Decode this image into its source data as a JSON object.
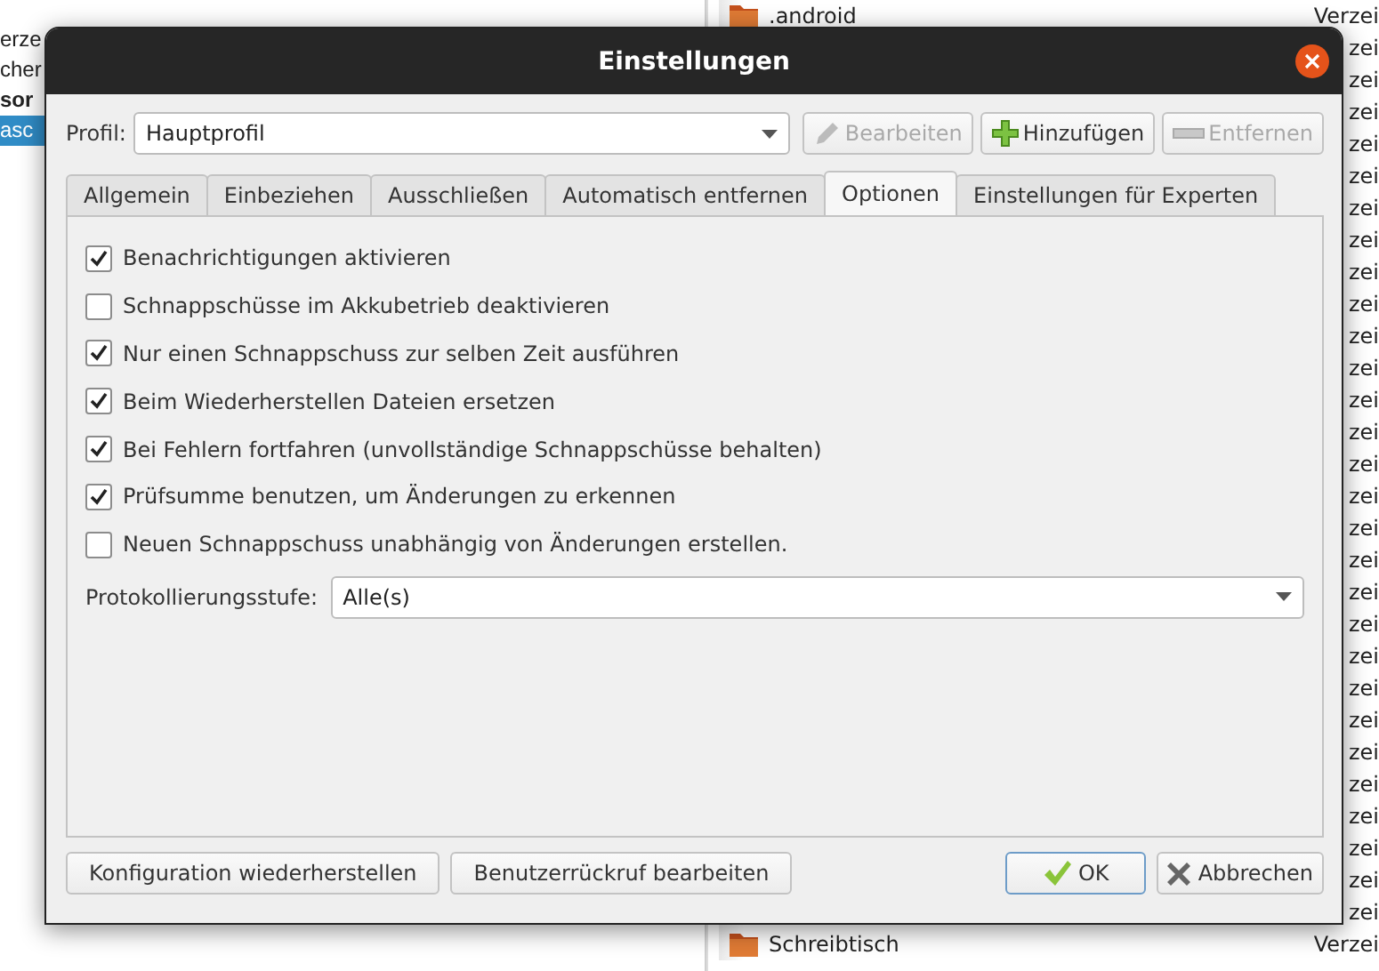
{
  "background": {
    "left_rows": [
      {
        "text": "erze",
        "bold": false,
        "selected": false
      },
      {
        "text": "cher",
        "bold": false,
        "selected": false
      },
      {
        "text": "sor",
        "bold": true,
        "selected": false
      },
      {
        "text": "asc",
        "bold": false,
        "selected": true
      }
    ],
    "file_rows": [
      {
        "name": ".android",
        "type": "Verzei"
      },
      {
        "type": "zei"
      },
      {
        "type": "zei"
      },
      {
        "type": "zei"
      },
      {
        "type": "zei"
      },
      {
        "type": "zei"
      },
      {
        "type": "zei"
      },
      {
        "type": "zei"
      },
      {
        "type": "zei"
      },
      {
        "type": "zei"
      },
      {
        "type": "zei"
      },
      {
        "type": "zei"
      },
      {
        "type": "zei"
      },
      {
        "type": "zei"
      },
      {
        "type": "zei"
      },
      {
        "type": "zei"
      },
      {
        "type": "zei"
      },
      {
        "type": "zei"
      },
      {
        "type": "zei"
      },
      {
        "type": "zei"
      },
      {
        "type": "zei"
      },
      {
        "type": "zei"
      },
      {
        "type": "zei"
      },
      {
        "type": "zei"
      },
      {
        "type": "zei"
      },
      {
        "type": "zei"
      },
      {
        "type": "zei"
      },
      {
        "type": "zei"
      },
      {
        "type": "zei"
      },
      {
        "name": "Schreibtisch",
        "type": "Verzei"
      }
    ]
  },
  "window": {
    "title": "Einstellungen"
  },
  "profile": {
    "label": "Profil:",
    "value": "Hauptprofil",
    "buttons": [
      {
        "kind": "edit",
        "label": "Bearbeiten",
        "disabled": true
      },
      {
        "kind": "add",
        "label": "Hinzufügen",
        "disabled": false
      },
      {
        "kind": "remove",
        "label": "Entfernen",
        "disabled": true
      }
    ]
  },
  "tabs": [
    {
      "label": "Allgemein",
      "selected": false
    },
    {
      "label": "Einbeziehen",
      "selected": false
    },
    {
      "label": "Ausschließen",
      "selected": false
    },
    {
      "label": "Automatisch entfernen",
      "selected": false
    },
    {
      "label": "Optionen",
      "selected": true
    },
    {
      "label": "Einstellungen für Experten",
      "selected": false
    }
  ],
  "options": [
    {
      "label": "Benachrichtigungen aktivieren",
      "checked": true
    },
    {
      "label": "Schnappschüsse im Akkubetrieb deaktivieren",
      "checked": false
    },
    {
      "label": "Nur einen Schnappschuss zur selben Zeit ausführen",
      "checked": true
    },
    {
      "label": "Beim Wiederherstellen Dateien ersetzen",
      "checked": true
    },
    {
      "label": "Bei Fehlern fortfahren (unvollständige Schnappschüsse behalten)",
      "checked": true
    },
    {
      "label": "Prüfsumme benutzen, um Änderungen zu erkennen",
      "checked": true
    },
    {
      "label": "Neuen Schnappschuss unabhängig von Änderungen erstellen.",
      "checked": false
    }
  ],
  "log_level": {
    "label": "Protokollierungsstufe:",
    "value": "Alle(s)"
  },
  "footer": {
    "left_buttons": [
      "Konfiguration wiederherstellen",
      "Benutzerrückruf bearbeiten"
    ],
    "right_buttons": [
      {
        "kind": "ok",
        "label": "OK"
      },
      {
        "kind": "cancel",
        "label": "Abbrechen"
      }
    ]
  }
}
